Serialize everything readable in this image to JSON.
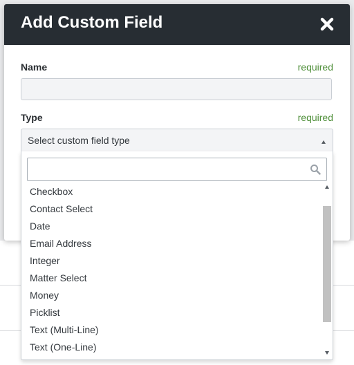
{
  "modal": {
    "title": "Add Custom Field",
    "close_icon": "close-icon"
  },
  "fields": {
    "name_label": "Name",
    "name_required": "required",
    "name_value": "",
    "type_label": "Type",
    "type_required": "required"
  },
  "type_select": {
    "selected_text": "Select custom field type",
    "search_value": "",
    "search_icon": "search-icon",
    "options": [
      "Checkbox",
      "Contact Select",
      "Date",
      "Email Address",
      "Integer",
      "Matter Select",
      "Money",
      "Picklist",
      "Text (Multi-Line)",
      "Text (One-Line)"
    ]
  },
  "colors": {
    "header_bg": "#272d33",
    "required_green": "#4f8f3a"
  }
}
